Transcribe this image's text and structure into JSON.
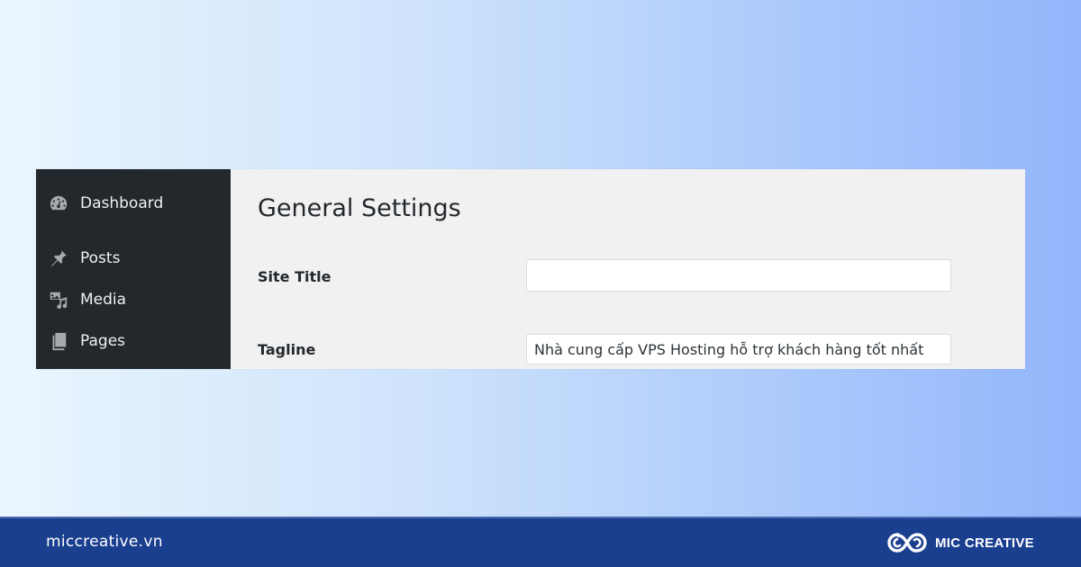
{
  "sidebar": {
    "items": [
      {
        "label": "Dashboard",
        "icon": "dashboard-icon"
      },
      {
        "label": "Posts",
        "icon": "pin-icon"
      },
      {
        "label": "Media",
        "icon": "media-icon"
      },
      {
        "label": "Pages",
        "icon": "pages-icon"
      }
    ]
  },
  "main": {
    "title": "General Settings",
    "fields": {
      "site_title": {
        "label": "Site Title",
        "value": ""
      },
      "tagline": {
        "label": "Tagline",
        "value": "Nhà cung cấp VPS Hosting hỗ trợ khách hàng tốt nhất"
      }
    }
  },
  "footer": {
    "url": "miccreative.vn",
    "brand": "MIC CREATIVE",
    "brand_icon": "mic-creative-logo"
  },
  "colors": {
    "sidebar_bg": "#23282d",
    "content_bg": "#f1f1f1",
    "footer_bg": "#1b3f8f"
  }
}
